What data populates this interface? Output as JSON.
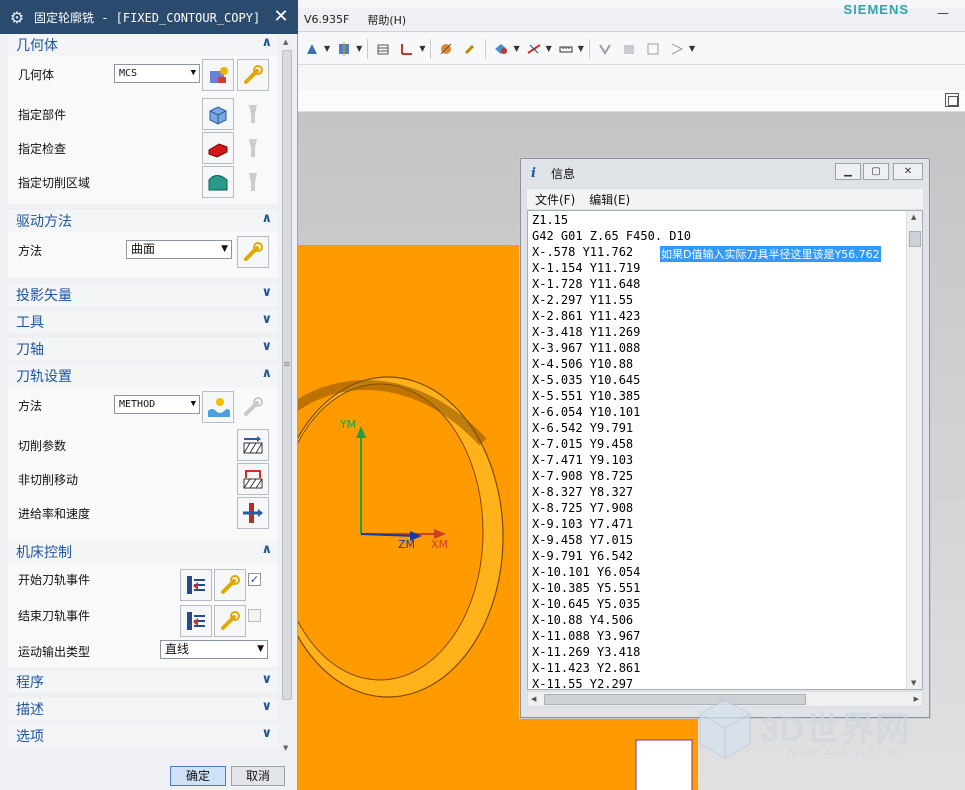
{
  "dialog": {
    "title": "固定轮廓铣 - [FIXED_CONTOUR_COPY]",
    "sections": {
      "geometry": "几何体",
      "drive_method": "驱动方法",
      "projection_vector": "投影矢量",
      "tool": "工具",
      "tool_axis": "刀轴",
      "path_settings": "刀轨设置",
      "machine_control": "机床控制",
      "program": "程序",
      "description": "描述",
      "options": "选项"
    },
    "geometry": {
      "geometry_label": "几何体",
      "geometry_value": "MCS",
      "part_label": "指定部件",
      "check_label": "指定检查",
      "cut_area_label": "指定切削区域"
    },
    "drive": {
      "method_label": "方法",
      "method_value": "曲面"
    },
    "path": {
      "method_label": "方法",
      "method_value": "METHOD",
      "cut_params": "切削参数",
      "non_cut_moves": "非切削移动",
      "feeds_speeds": "进给率和速度"
    },
    "machine": {
      "start_events": "开始刀轨事件",
      "start_checked": true,
      "end_events": "结束刀轨事件",
      "end_checked": false,
      "motion_output_label": "运动输出类型",
      "motion_output_value": "直线"
    },
    "ok": "确定",
    "cancel": "取消"
  },
  "app": {
    "menu_version": "V6.935F",
    "menu_help": "帮助(H)",
    "brand": "SIEMENS"
  },
  "viewport": {
    "axis_ym": "YM",
    "axis_zm": "ZM",
    "axis_xm": "XM",
    "part_color": "#ff9a00"
  },
  "info": {
    "title": "信息",
    "menu_file": "文件(F)",
    "menu_edit": "编辑(E)",
    "note": "如果D值输入实际刀具半径这里该是Y56.762",
    "lines": [
      "Z1.15",
      "G42 G01 Z.65 F450. D10",
      "X-.578 Y11.762",
      "X-1.154 Y11.719",
      "X-1.728 Y11.648",
      "X-2.297 Y11.55",
      "X-2.861 Y11.423",
      "X-3.418 Y11.269",
      "X-3.967 Y11.088",
      "X-4.506 Y10.88",
      "X-5.035 Y10.645",
      "X-5.551 Y10.385",
      "X-6.054 Y10.101",
      "X-6.542 Y9.791",
      "X-7.015 Y9.458",
      "X-7.471 Y9.103",
      "X-7.908 Y8.725",
      "X-8.327 Y8.327",
      "X-8.725 Y7.908",
      "X-9.103 Y7.471",
      "X-9.458 Y7.015",
      "X-9.791 Y6.542",
      "X-10.101 Y6.054",
      "X-10.385 Y5.551",
      "X-10.645 Y5.035",
      "X-10.88 Y4.506",
      "X-11.088 Y3.967",
      "X-11.269 Y3.418",
      "X-11.423 Y2.861",
      "X-11.55 Y2.297"
    ]
  },
  "watermark": {
    "text": "3D世界网",
    "url": "WWW.3DSJW.COM"
  }
}
